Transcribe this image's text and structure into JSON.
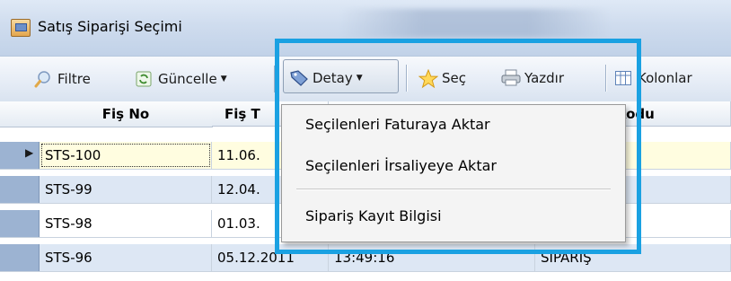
{
  "window": {
    "title": "Satış Siparişi Seçimi"
  },
  "toolbar": {
    "filter_label": "Filtre",
    "refresh_label": "Güncelle",
    "detail_label": "Detay",
    "select_label": "Seç",
    "print_label": "Yazdır",
    "columns_label": "Kolonlar"
  },
  "grid": {
    "columns": [
      "Fiş No",
      "Fiş T",
      "ri Kodu"
    ],
    "rows": [
      {
        "fis_no": "STS-100",
        "date": "11.06.",
        "time": "",
        "code": ""
      },
      {
        "fis_no": "STS-99",
        "date": "12.04.",
        "time": "",
        "code": ""
      },
      {
        "fis_no": "STS-98",
        "date": "01.03.",
        "time": "",
        "code": ""
      },
      {
        "fis_no": "STS-96",
        "date": "05.12.2011",
        "time": "13:49:16",
        "code": "SİPARİŞ"
      }
    ]
  },
  "detail_menu": {
    "items": [
      "Seçilenleri Faturaya Aktar",
      "Seçilenleri İrsaliyeye Aktar",
      "Sipariş Kayıt Bilgisi"
    ]
  },
  "colors": {
    "highlight_border": "#1aa1e2",
    "selected_row": "#fffde0",
    "alt_row": "#dde7f4"
  }
}
